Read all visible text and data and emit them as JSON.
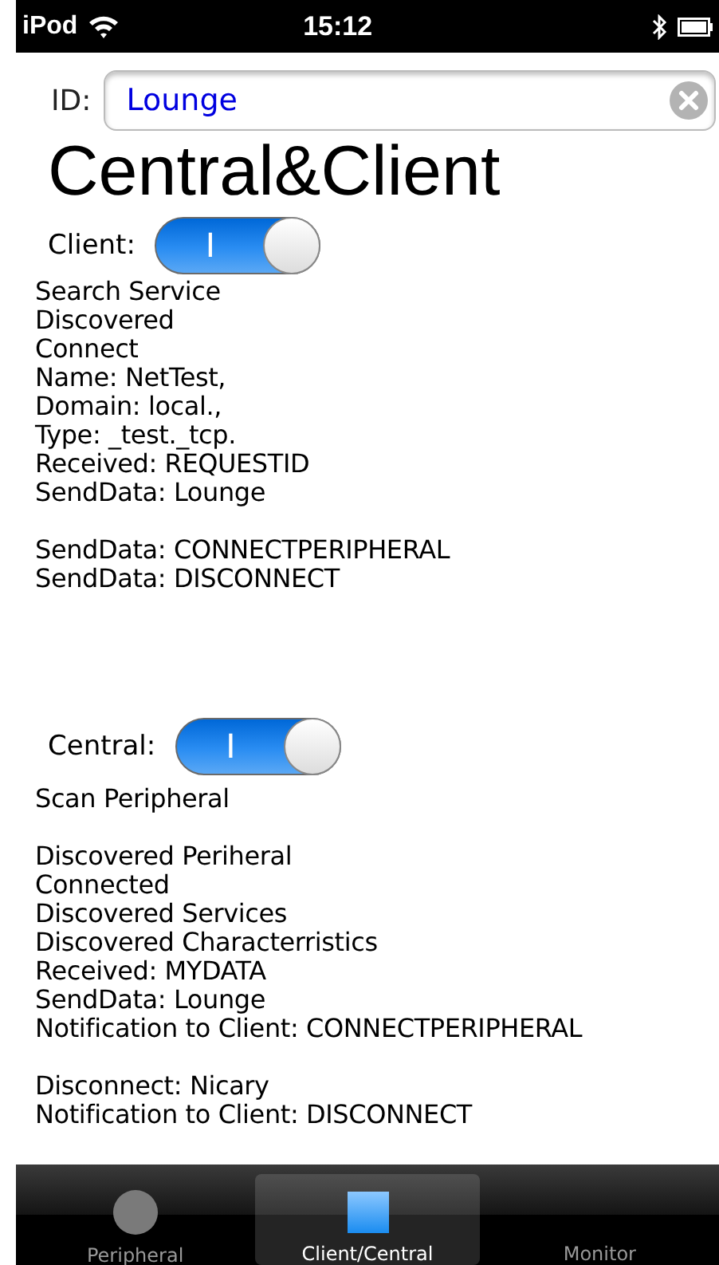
{
  "status_bar": {
    "carrier": "iPod",
    "time": "15:12"
  },
  "id_field": {
    "label": "ID:",
    "value": "Lounge"
  },
  "title": "Central&Client",
  "sections": [
    {
      "label": "Client:",
      "switch_on": true,
      "switch_text": "I",
      "log": [
        [
          "Search Service",
          "Discovered",
          "Connect",
          "Name: NetTest,",
          "Domain: local.,",
          "Type: _test._tcp.",
          "Received: REQUESTID",
          "SendData: Lounge"
        ],
        [
          "SendData: CONNECTPERIPHERAL",
          "SendData: DISCONNECT"
        ]
      ]
    },
    {
      "label": "Central:",
      "switch_on": true,
      "switch_text": "I",
      "log": [
        [
          "Scan Peripheral"
        ],
        [
          "Discovered Periheral",
          "Connected",
          "Discovered Services",
          "Discovered Characterristics",
          "Received: MYDATA",
          "SendData: Lounge",
          "Notification to Client: CONNECTPERIPHERAL"
        ],
        [
          "Disconnect: Nicary",
          "Notification to Client: DISCONNECT"
        ]
      ]
    }
  ],
  "tabs": [
    {
      "label": "Peripheral",
      "kind": "circle",
      "selected": false
    },
    {
      "label": "Client/Central",
      "kind": "square",
      "selected": true
    },
    {
      "label": "Monitor",
      "kind": "none",
      "selected": false
    }
  ]
}
